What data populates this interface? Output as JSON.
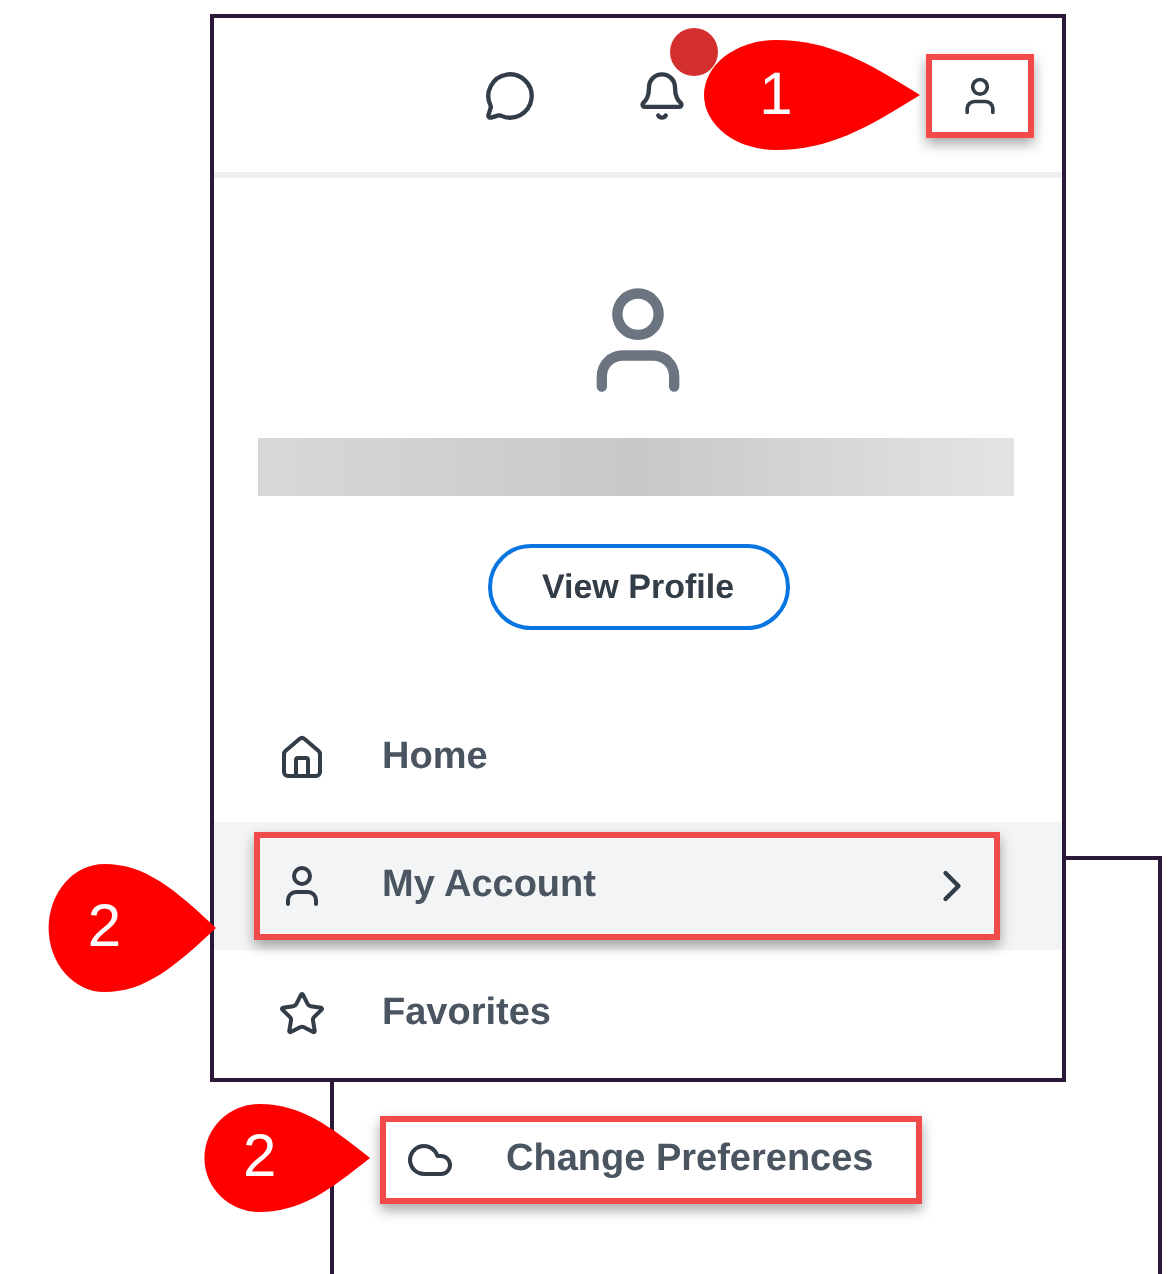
{
  "top_bar": {
    "notifications_badge": true,
    "profile_highlighted": true
  },
  "profile": {
    "button": "View Profile"
  },
  "menu": [
    {
      "label": "Home",
      "selected": false,
      "highlighted": false,
      "has_submenu": false
    },
    {
      "label": "My Account",
      "selected": true,
      "highlighted": true,
      "has_submenu": true
    },
    {
      "label": "Favorites",
      "selected": false,
      "highlighted": false,
      "has_submenu": false
    }
  ],
  "submenu": [
    {
      "label": "Change Preferences",
      "highlighted": true
    }
  ],
  "callouts": [
    {
      "label": "1"
    },
    {
      "label": "2"
    },
    {
      "label": "2"
    }
  ]
}
